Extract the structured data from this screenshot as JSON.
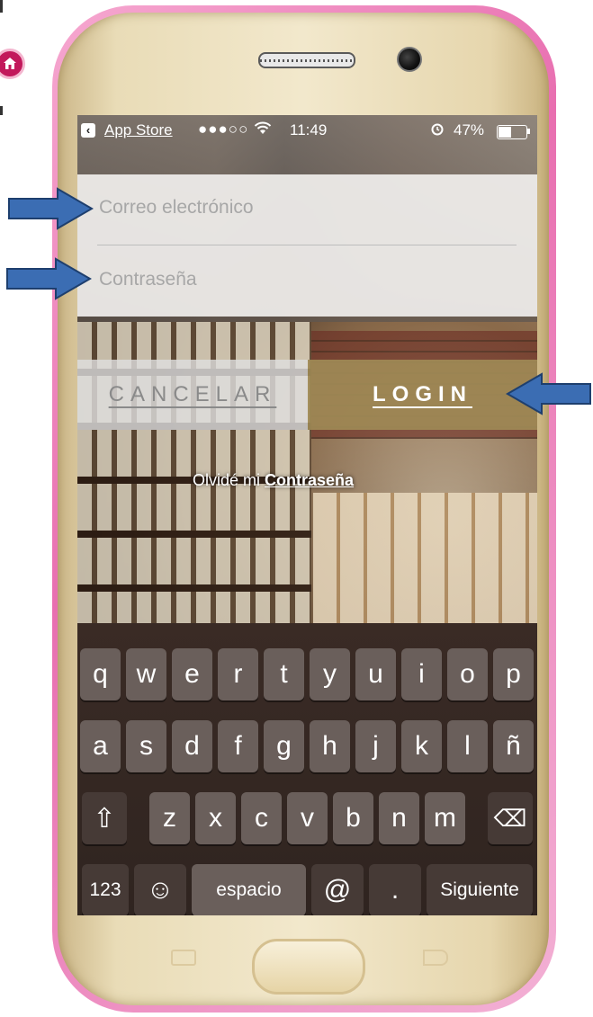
{
  "status_bar": {
    "back_app": "App Store",
    "signal": "●●●○○",
    "time": "11:49",
    "battery": "47%",
    "battery_level": 0.47
  },
  "login": {
    "email_placeholder": "Correo electrónico",
    "password_placeholder": "Contraseña",
    "cancel_label": "CANCELAR",
    "login_label": "LOGIN",
    "forgot_prefix": "Olvidé mi",
    "forgot_link": "Contraseña"
  },
  "keyboard": {
    "row1": [
      "q",
      "w",
      "e",
      "r",
      "t",
      "y",
      "u",
      "i",
      "o",
      "p"
    ],
    "row2": [
      "a",
      "s",
      "d",
      "f",
      "g",
      "h",
      "j",
      "k",
      "l",
      "ñ"
    ],
    "row3": [
      "z",
      "x",
      "c",
      "v",
      "b",
      "n",
      "m"
    ],
    "numbers": "123",
    "emoji": "☺",
    "space": "espacio",
    "at": "@",
    "dot": ".",
    "next": "Siguiente",
    "shift": "⇧",
    "delete": "⌫"
  },
  "colors": {
    "phone_frame": "#e86fb0",
    "phone_gold": "#e9dcb7",
    "login_button": "#a08a56",
    "arrow_blue": "#3b6db3",
    "home_badge": "#c2185b"
  }
}
